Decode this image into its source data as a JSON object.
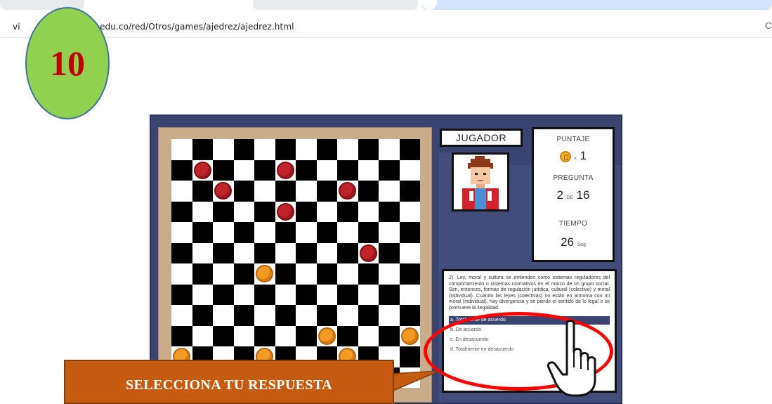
{
  "browser": {
    "url_left": "vi",
    "url_right": "ca.edu.co/red/Otros/games/ajedrez/ajedrez.html",
    "trail_glyph": "C"
  },
  "step_badge": {
    "number": "10",
    "color": "#92d050",
    "text_color": "#c00000"
  },
  "game": {
    "player_label": "JUGADOR",
    "score": {
      "label": "PUNTAJE",
      "multiplier": "x",
      "value": "1"
    },
    "question_counter": {
      "label": "PREGUNTA",
      "current": "2",
      "of": "DE",
      "total": "16"
    },
    "time": {
      "label": "TIEMPO",
      "value": "26",
      "unit": "Seg"
    },
    "question_text": "2). Ley, moral y cultura se entienden como sistemas reguladores del comportamiento o sistemas normativos en el marco de un grupo social. Son, entonces, formas de regulación jurídica, cultural (colectivo) y moral (individual). Cuando las leyes (colectivas) no están en armonía con mi moral (individual), hay divergencia y se pierde el sentido de lo legal o se promueve la ilegalidad.",
    "options": [
      {
        "label": "a. Totalmente de acuerdo",
        "selected": true
      },
      {
        "label": "b. De acuerdo",
        "selected": false
      },
      {
        "label": "c. En desacuerdo",
        "selected": false
      },
      {
        "label": "d. Totalmente en desacuerdo",
        "selected": false
      }
    ],
    "board": {
      "size": 12,
      "red_pieces": [
        [
          1,
          1
        ],
        [
          1,
          5
        ],
        [
          2,
          2
        ],
        [
          2,
          8
        ],
        [
          3,
          5
        ],
        [
          5,
          9
        ]
      ],
      "orange_pieces": [
        [
          6,
          4
        ],
        [
          9,
          7
        ],
        [
          9,
          11
        ],
        [
          10,
          0
        ],
        [
          10,
          4
        ],
        [
          10,
          8
        ]
      ]
    },
    "colors": {
      "frame": "#3b4470",
      "red_piece": "#c0232b",
      "orange_piece": "#f39a24",
      "board_border": "#c9ad8a"
    }
  },
  "annotation": {
    "callout_text": "SELECCIONA TU RESPUESTA",
    "callout_color": "#c55a11",
    "ellipse_color": "#ff0000"
  }
}
